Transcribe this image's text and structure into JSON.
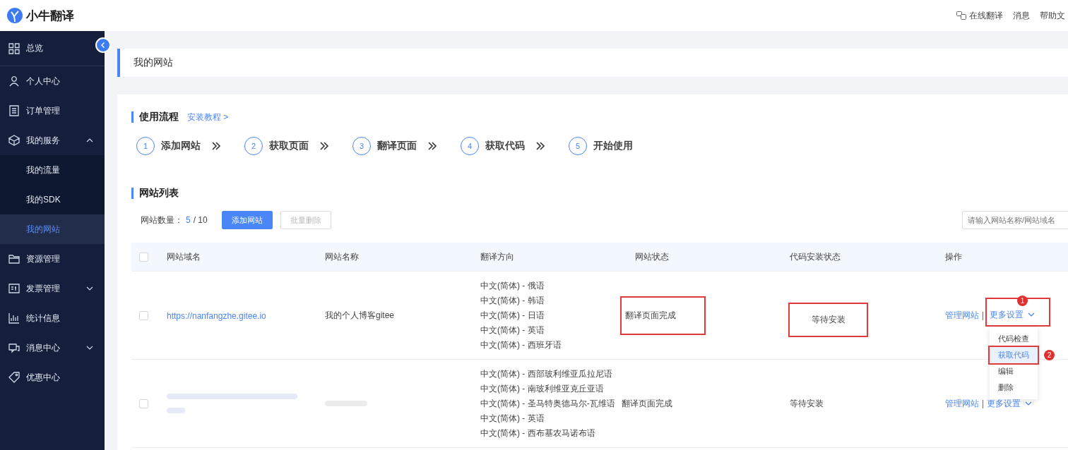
{
  "header": {
    "logo_text": "小牛翻译",
    "links": [
      "在线翻译",
      "消息",
      "帮助文"
    ]
  },
  "sidebar": {
    "items": [
      {
        "label": "总览",
        "selected": false
      },
      {
        "label": "个人中心",
        "selected": false
      },
      {
        "label": "订单管理",
        "selected": false
      },
      {
        "label": "我的服务",
        "selected": false,
        "expanded": true,
        "children": [
          {
            "label": "我的流量",
            "selected": false
          },
          {
            "label": "我的SDK",
            "selected": false
          },
          {
            "label": "我的网站",
            "selected": true
          }
        ]
      },
      {
        "label": "资源管理",
        "selected": false
      },
      {
        "label": "发票管理",
        "selected": false,
        "expanded": false
      },
      {
        "label": "统计信息",
        "selected": false
      },
      {
        "label": "消息中心",
        "selected": false,
        "expanded": false
      },
      {
        "label": "优惠中心",
        "selected": false
      }
    ]
  },
  "page_title": "我的网站",
  "process": {
    "title": "使用流程",
    "link": "安装教程 >",
    "steps": [
      {
        "number": "1",
        "label": "添加网站"
      },
      {
        "number": "2",
        "label": "获取页面"
      },
      {
        "number": "3",
        "label": "翻译页面"
      },
      {
        "number": "4",
        "label": "获取代码"
      },
      {
        "number": "5",
        "label": "开始使用"
      }
    ]
  },
  "site_list": {
    "title": "网站列表",
    "count_label": "网站数量：",
    "count": "5",
    "total": "/ 10",
    "add_button": "添加网站",
    "delete_button": {
      "label": "批量删除",
      "disabled": true
    },
    "search": {
      "placeholder": "请输入网站名称/网站域名"
    }
  },
  "table": {
    "select_all_checked": false,
    "columns": [
      "网站域名",
      "网站名称",
      "翻译方向",
      "网站状态",
      "代码安装状态",
      "操作"
    ],
    "rows": [
      {
        "checked": false,
        "domain": "https://nanfangzhe.gitee.io",
        "name": "我的个人博客gitee",
        "redacted": false,
        "directions": [
          "中文(简体) - 俄语",
          "中文(简体) - 韩语",
          "中文(简体) - 日语",
          "中文(简体) - 英语",
          "中文(简体) - 西班牙语"
        ],
        "status": "翻译页面完成",
        "install": "等待安装",
        "annotated": true,
        "manage": "管理网站",
        "separator": "|",
        "more": "更多设置",
        "more_marker": "1",
        "menu": [
          {
            "label": "代码检查",
            "selected": false
          },
          {
            "label": "获取代码",
            "selected": true,
            "marker": "2"
          },
          {
            "label": "编辑",
            "selected": false
          },
          {
            "label": "删除",
            "selected": false
          }
        ]
      },
      {
        "checked": false,
        "redacted": true,
        "directions": [
          "中文(简体) - 西部玻利维亚瓜拉尼语",
          "中文(简体) - 南玻利维亚克丘亚语",
          "中文(简体) - 圣马特奥德马尔-瓦维语",
          "中文(简体) - 英语",
          "中文(简体) - 西布基农马诺布语"
        ],
        "status": "翻译页面完成",
        "install": "等待安装",
        "annotated": false,
        "manage": "管理网站",
        "separator": "|",
        "more": "更多设置"
      }
    ]
  }
}
